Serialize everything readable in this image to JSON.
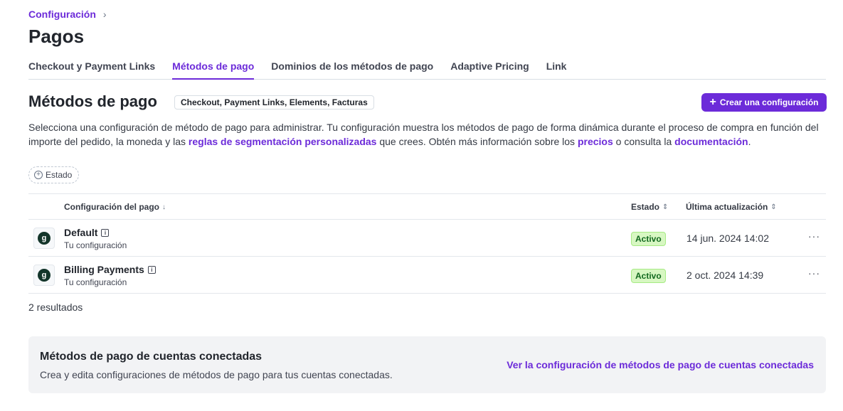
{
  "breadcrumb": {
    "root": "Configuración",
    "separator": "›"
  },
  "page_title": "Pagos",
  "tabs": [
    {
      "label": "Checkout y Payment Links",
      "active": false
    },
    {
      "label": "Métodos de pago",
      "active": true
    },
    {
      "label": "Dominios de los métodos de pago",
      "active": false
    },
    {
      "label": "Adaptive Pricing",
      "active": false
    },
    {
      "label": "Link",
      "active": false
    }
  ],
  "section": {
    "title": "Métodos de pago",
    "scope_badge": "Checkout, Payment Links, Elements, Facturas",
    "create_button": "Crear una configuración",
    "description": {
      "part1": "Selecciona una configuración de método de pago para administrar. Tu configuración muestra los métodos de pago de forma dinámica durante el proceso de compra en función del importe del pedido, la moneda y las ",
      "link1": "reglas de segmentación personalizadas",
      "part2": " que crees. Obtén más información sobre los ",
      "link2": "precios",
      "part3": " o consulta la ",
      "link3": "documentación",
      "part4": "."
    }
  },
  "filter": {
    "label": "Estado",
    "icon": "plus-circle-icon"
  },
  "table": {
    "columns": {
      "config": "Configuración del pago",
      "config_sort": "↓",
      "status": "Estado",
      "status_sort": "⇕",
      "updated": "Última actualización",
      "updated_sort": "⇕"
    },
    "rows": [
      {
        "logo": "g",
        "name": "Default",
        "subtitle": "Tu configuración",
        "status": "Activo",
        "updated": "14 jun. 2024 14:02"
      },
      {
        "logo": "g",
        "name": "Billing Payments",
        "subtitle": "Tu configuración",
        "status": "Activo",
        "updated": "2 oct. 2024 14:39"
      }
    ],
    "results": "2 resultados"
  },
  "connected": {
    "title": "Métodos de pago de cuentas conectadas",
    "description": "Crea y edita configuraciones de métodos de pago para tus cuentas conectadas.",
    "link": "Ver la configuración de métodos de pago de cuentas conectadas"
  },
  "colors": {
    "accent": "#6c2bd9",
    "status_bg": "#d7f7c2",
    "status_text": "#12691f",
    "logo_bg": "#13352a"
  }
}
